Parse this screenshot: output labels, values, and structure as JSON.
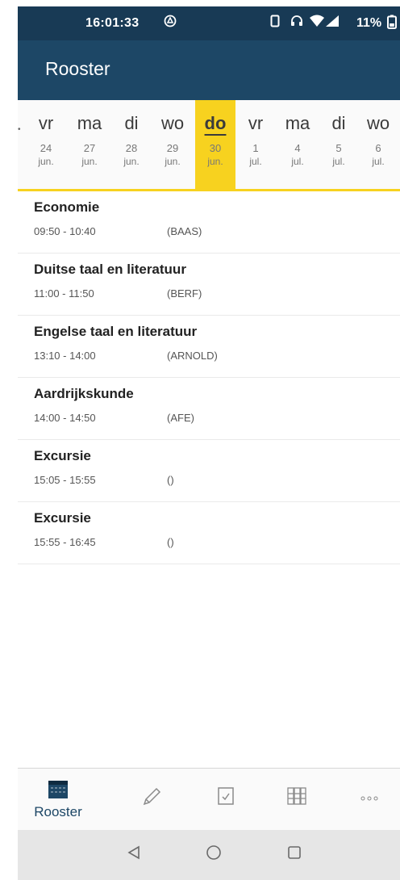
{
  "status": {
    "time": "16:01:33",
    "battery": "11%"
  },
  "app": {
    "title": "Rooster"
  },
  "days": [
    {
      "wd": "vr",
      "dn": "24",
      "mn": "jun."
    },
    {
      "wd": "ma",
      "dn": "27",
      "mn": "jun."
    },
    {
      "wd": "di",
      "dn": "28",
      "mn": "jun."
    },
    {
      "wd": "wo",
      "dn": "29",
      "mn": "jun."
    },
    {
      "wd": "do",
      "dn": "30",
      "mn": "jun."
    },
    {
      "wd": "vr",
      "dn": "1",
      "mn": "jul."
    },
    {
      "wd": "ma",
      "dn": "4",
      "mn": "jul."
    },
    {
      "wd": "di",
      "dn": "5",
      "mn": "jul."
    },
    {
      "wd": "wo",
      "dn": "6",
      "mn": "jul."
    }
  ],
  "lessons": [
    {
      "subject": "Economie",
      "time": "09:50 - 10:40",
      "teacher": "(BAAS)"
    },
    {
      "subject": "Duitse taal en literatuur",
      "time": "11:00 - 11:50",
      "teacher": "(BERF)"
    },
    {
      "subject": "Engelse taal en literatuur",
      "time": "13:10 - 14:00",
      "teacher": "(ARNOLD)"
    },
    {
      "subject": "Aardrijkskunde",
      "time": "14:00 - 14:50",
      "teacher": "(AFE)"
    },
    {
      "subject": "Excursie",
      "time": "15:05 - 15:55",
      "teacher": "()"
    },
    {
      "subject": "Excursie",
      "time": "15:55 - 16:45",
      "teacher": "()"
    }
  ],
  "nav": {
    "rooster_label": "Rooster"
  },
  "icons": {
    "statusbar": [
      "drive-icon",
      "phone-icon",
      "headset-icon",
      "wifi-icon",
      "signal-icon",
      "battery-icon"
    ],
    "bottomnav": [
      "calendar-icon",
      "pencil-icon",
      "checkbox-icon",
      "grid-icon",
      "more-icon"
    ],
    "sysnav": [
      "back-icon",
      "home-icon",
      "recents-icon"
    ]
  },
  "colors": {
    "statusbar": "#183a55",
    "appbar": "#1d4766",
    "selected_day": "#f7d21f"
  }
}
